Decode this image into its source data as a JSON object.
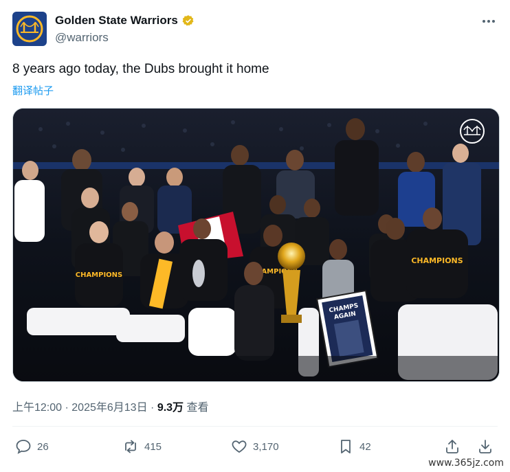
{
  "account": {
    "display_name": "Golden State Warriors",
    "handle": "@warriors",
    "verified_icon": "verified-badge-icon",
    "avatar_icon": "warriors-bridge-logo"
  },
  "tweet": {
    "text": "8 years ago today, the Dubs brought it home",
    "translate_label": "翻译帖子"
  },
  "media": {
    "description_icon": "team-celebration-photo",
    "board_line1": "CHAMPS",
    "board_line2": "AGAIN"
  },
  "meta": {
    "time": "上午12:00",
    "separator": "·",
    "date": "2025年6月13日",
    "views": "9.3万",
    "views_label": "查看"
  },
  "actions": {
    "reply_count": "26",
    "retweet_count": "415",
    "like_count": "3,170",
    "bookmark_count": "42"
  },
  "watermark": "www.365jz.com",
  "colors": {
    "accent": "#1d9bf0",
    "secondary_text": "#536471",
    "gold": "#fdb927",
    "navy": "#1d428a"
  }
}
